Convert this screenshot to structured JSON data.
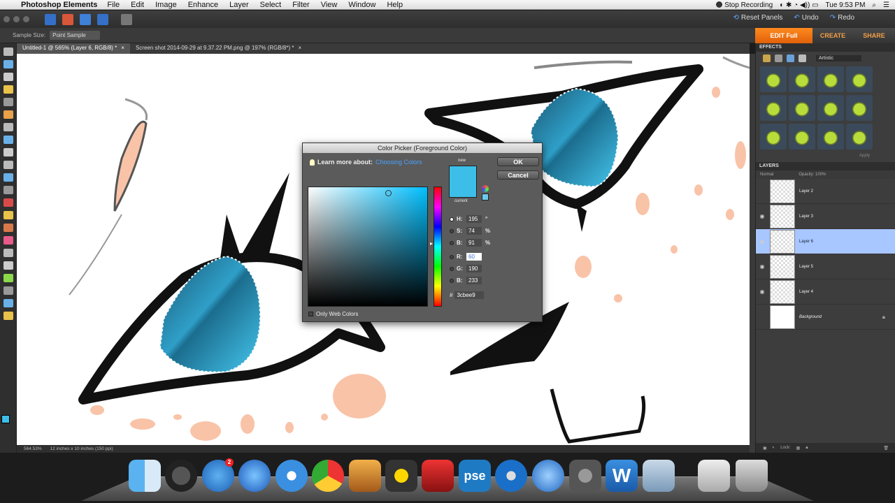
{
  "menubar": {
    "app_name": "Photoshop Elements",
    "items": [
      "File",
      "Edit",
      "Image",
      "Enhance",
      "Layer",
      "Select",
      "Filter",
      "View",
      "Window",
      "Help"
    ],
    "stop_recording": "Stop Recording",
    "clock": "Tue 9:53 PM"
  },
  "toolbar": {
    "reset_panels": "Reset Panels",
    "undo": "Undo",
    "redo": "Redo"
  },
  "options": {
    "sample_size_label": "Sample Size:",
    "sample_size_value": "Point Sample"
  },
  "modes": {
    "edit": "EDIT Full",
    "create": "CREATE",
    "share": "SHARE"
  },
  "documents": [
    {
      "title": "Untitled-1 @ 565% (Layer 6, RGB/8) *",
      "close": "×"
    },
    {
      "title": "Screen shot 2014-09-29 at 9.37.22 PM.png @ 197% (RGB/8*) *",
      "close": "×"
    }
  ],
  "status": {
    "zoom": "564.53%",
    "doc_size": "12 inches x 10 inches (150 ppi)"
  },
  "effects": {
    "header": "EFFECTS",
    "category": "Artistic",
    "apply": "Apply"
  },
  "layers": {
    "header": "LAYERS",
    "blend_mode": "Normal",
    "opacity_label": "Opacity:",
    "opacity_value": "100%",
    "lock_label": "Lock:",
    "items": [
      {
        "name": "Layer 2",
        "visible": false
      },
      {
        "name": "Layer 3",
        "visible": true
      },
      {
        "name": "Layer 6",
        "visible": true
      },
      {
        "name": "Layer 5",
        "visible": true
      },
      {
        "name": "Layer 4",
        "visible": true
      },
      {
        "name": "Background",
        "visible": false
      }
    ]
  },
  "color_picker": {
    "title": "Color Picker (Foreground Color)",
    "learn_more": "Learn more about:",
    "learn_link": "Choosing Colors",
    "ok": "OK",
    "cancel": "Cancel",
    "new_label": "new",
    "current_label": "current",
    "h_label": "H:",
    "h_value": "195",
    "h_unit": "°",
    "s_label": "S:",
    "s_value": "74",
    "s_unit": "%",
    "b_label": "B:",
    "b_value": "91",
    "b_unit": "%",
    "r_label": "R:",
    "r_value": "60",
    "g_label": "G:",
    "g_value": "190",
    "bl_label": "B:",
    "bl_value": "233",
    "hex_label": "#",
    "hex_value": "3cbee9",
    "web_only": "Only Web Colors",
    "color": "#3cbee9"
  },
  "dock": {
    "appstore_badge": "2",
    "apps": [
      "finder-icon",
      "dashboard-icon",
      "app-store-icon",
      "itunes-icon",
      "safari-icon",
      "chrome-icon",
      "iphoto-icon",
      "imovie-icon",
      "photo-booth-icon",
      "photoshop-elements-icon",
      "dvd-player-icon",
      "quicktime-icon",
      "system-preferences-icon",
      "word-icon",
      "preview-icon",
      "downloads-icon",
      "trash-icon"
    ]
  },
  "colors": {
    "accent_orange": "#f07a16",
    "selection_blue": "#a8c6ff",
    "eye_blue": "#3cbee9",
    "skin_peach": "#f9c3a8"
  }
}
